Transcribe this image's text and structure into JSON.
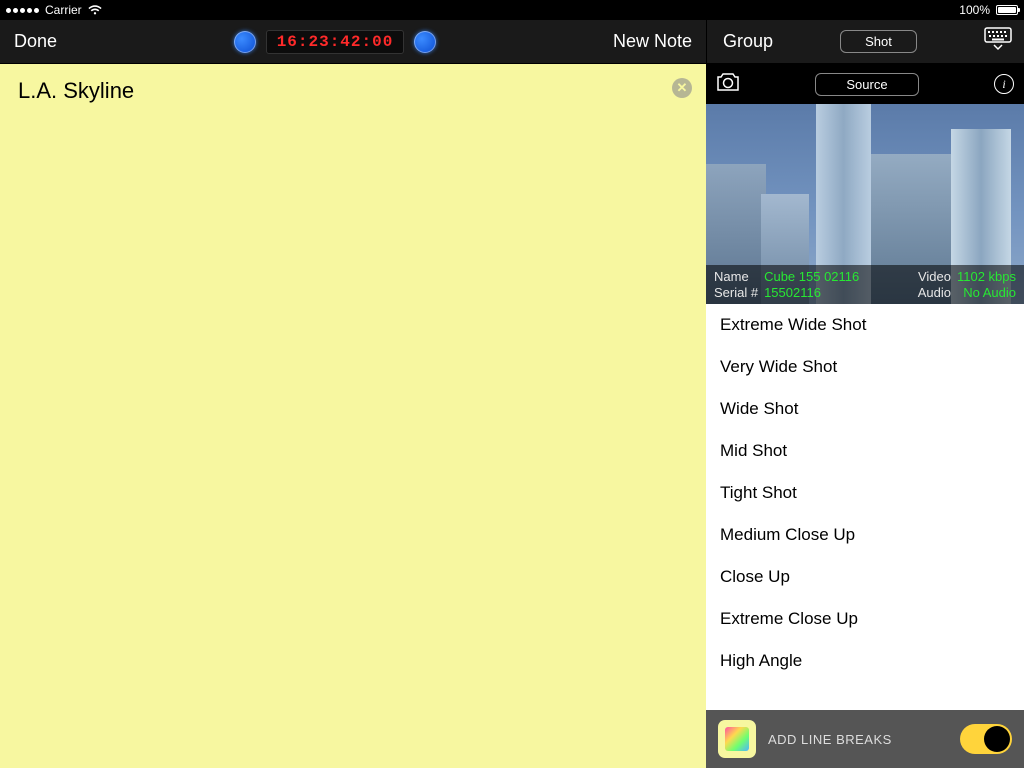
{
  "status": {
    "carrier": "Carrier",
    "battery_pct": "100%"
  },
  "toolbar": {
    "done": "Done",
    "timecode": "16:23:42:00",
    "new_note": "New Note",
    "group_label": "Group",
    "segment_label": "Shot"
  },
  "note": {
    "text": "L.A. Skyline"
  },
  "source_header": {
    "button": "Source"
  },
  "preview_meta": {
    "name_label": "Name",
    "name_value": "Cube 155 02116",
    "serial_label": "Serial #",
    "serial_value": "15502116",
    "video_label": "Video",
    "video_value": "1102 kbps",
    "audio_label": "Audio",
    "audio_value": "No Audio"
  },
  "shot_types": [
    "Extreme Wide Shot",
    "Very Wide Shot",
    "Wide Shot",
    "Mid Shot",
    "Tight Shot",
    "Medium Close Up",
    "Close Up",
    "Extreme Close Up",
    "High Angle"
  ],
  "footer": {
    "label": "ADD LINE BREAKS",
    "toggle_on": true
  }
}
